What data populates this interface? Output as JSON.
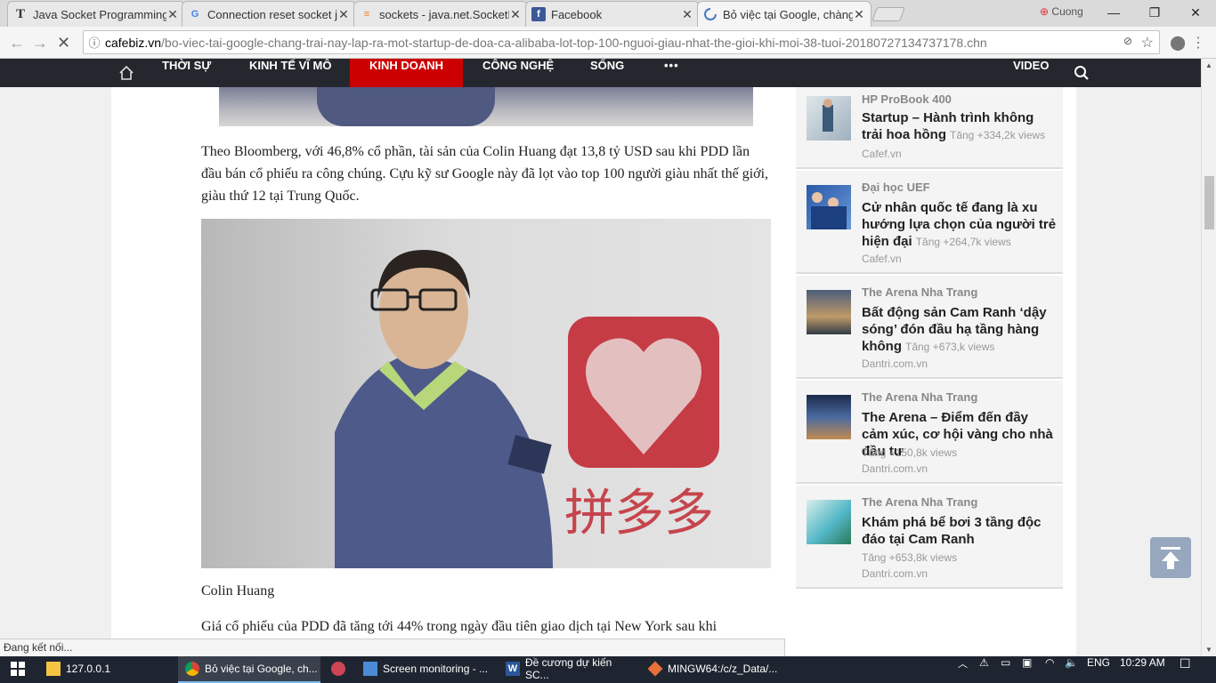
{
  "browser": {
    "tabs": [
      {
        "title": "Java Socket Programming",
        "icon": "T"
      },
      {
        "title": "Connection reset socket j",
        "icon": "G"
      },
      {
        "title": "sockets - java.net.SocketE",
        "icon": "so"
      },
      {
        "title": "Facebook",
        "icon": "f"
      },
      {
        "title": "Bỏ việc tại Google, chàng",
        "icon": "loading"
      }
    ],
    "user": "Cuong",
    "url_domain": "cafebiz.vn",
    "url_path": "/bo-viec-tai-google-chang-trai-nay-lap-ra-mot-startup-de-doa-ca-alibaba-lot-top-100-nguoi-giau-nhat-the-gioi-khi-moi-38-tuoi-20180727134737178.chn"
  },
  "nav": {
    "items": [
      "THỜI SỰ",
      "KINH TẾ VĨ MÔ",
      "KINH DOANH",
      "CÔNG NGHỆ",
      "SỐNG",
      "•••"
    ],
    "video": "VIDEO",
    "active_color": "#cc0000"
  },
  "article": {
    "para1": "Theo Bloomberg, với 46,8% cổ phần, tài sản của Colin Huang đạt 13,8 tỷ USD sau khi PDD lần đầu bán cổ phiếu ra công chúng. Cựu kỹ sư Google này đã lọt vào top 100 người giàu nhất thế giới, giàu thứ 12 tại Trung Quốc.",
    "caption": "Colin Huang",
    "para2": "Giá cổ phiếu của PDD đã tăng tới 44% trong ngày đầu tiên giao dịch tại New York sau khi"
  },
  "sidebar": [
    {
      "sponsor": "HP ProBook 400",
      "title": "Startup – Hành trình không trải hoa hồng",
      "views": "Tăng +334,2k views",
      "source": "Cafef.vn"
    },
    {
      "sponsor": "Đại học UEF",
      "title": "Cử nhân quốc tế đang là xu hướng lựa chọn của người trẻ hiện đại",
      "views": "Tăng +264,7k views",
      "source": "Cafef.vn"
    },
    {
      "sponsor": "The Arena Nha Trang",
      "title": "Bất động sản Cam Ranh ‘dậy sóng’ đón đầu hạ tầng hàng không",
      "views": "Tăng +673,k views",
      "source": "Dantri.com.vn"
    },
    {
      "sponsor": "The Arena Nha Trang",
      "title": "The Arena – Điểm đến đầy cảm xúc, cơ hội vàng cho nhà đầu tư",
      "views": "Tăng +150,8k views",
      "source": "Dantri.com.vn"
    },
    {
      "sponsor": "The Arena Nha Trang",
      "title": "Khám phá bể bơi 3 tầng độc đáo tại Cam Ranh",
      "views": "Tăng +653,8k views",
      "source": "Dantri.com.vn"
    }
  ],
  "status_text": "Đang kết nối...",
  "taskbar": {
    "items": [
      "127.0.0.1",
      "Bỏ việc tại Google, ch...",
      "",
      "Screen monitoring - ...",
      "Đề cương dự kiến SC...",
      "MINGW64:/c/z_Data/..."
    ],
    "lang": "ENG",
    "time": "10:29 AM"
  }
}
